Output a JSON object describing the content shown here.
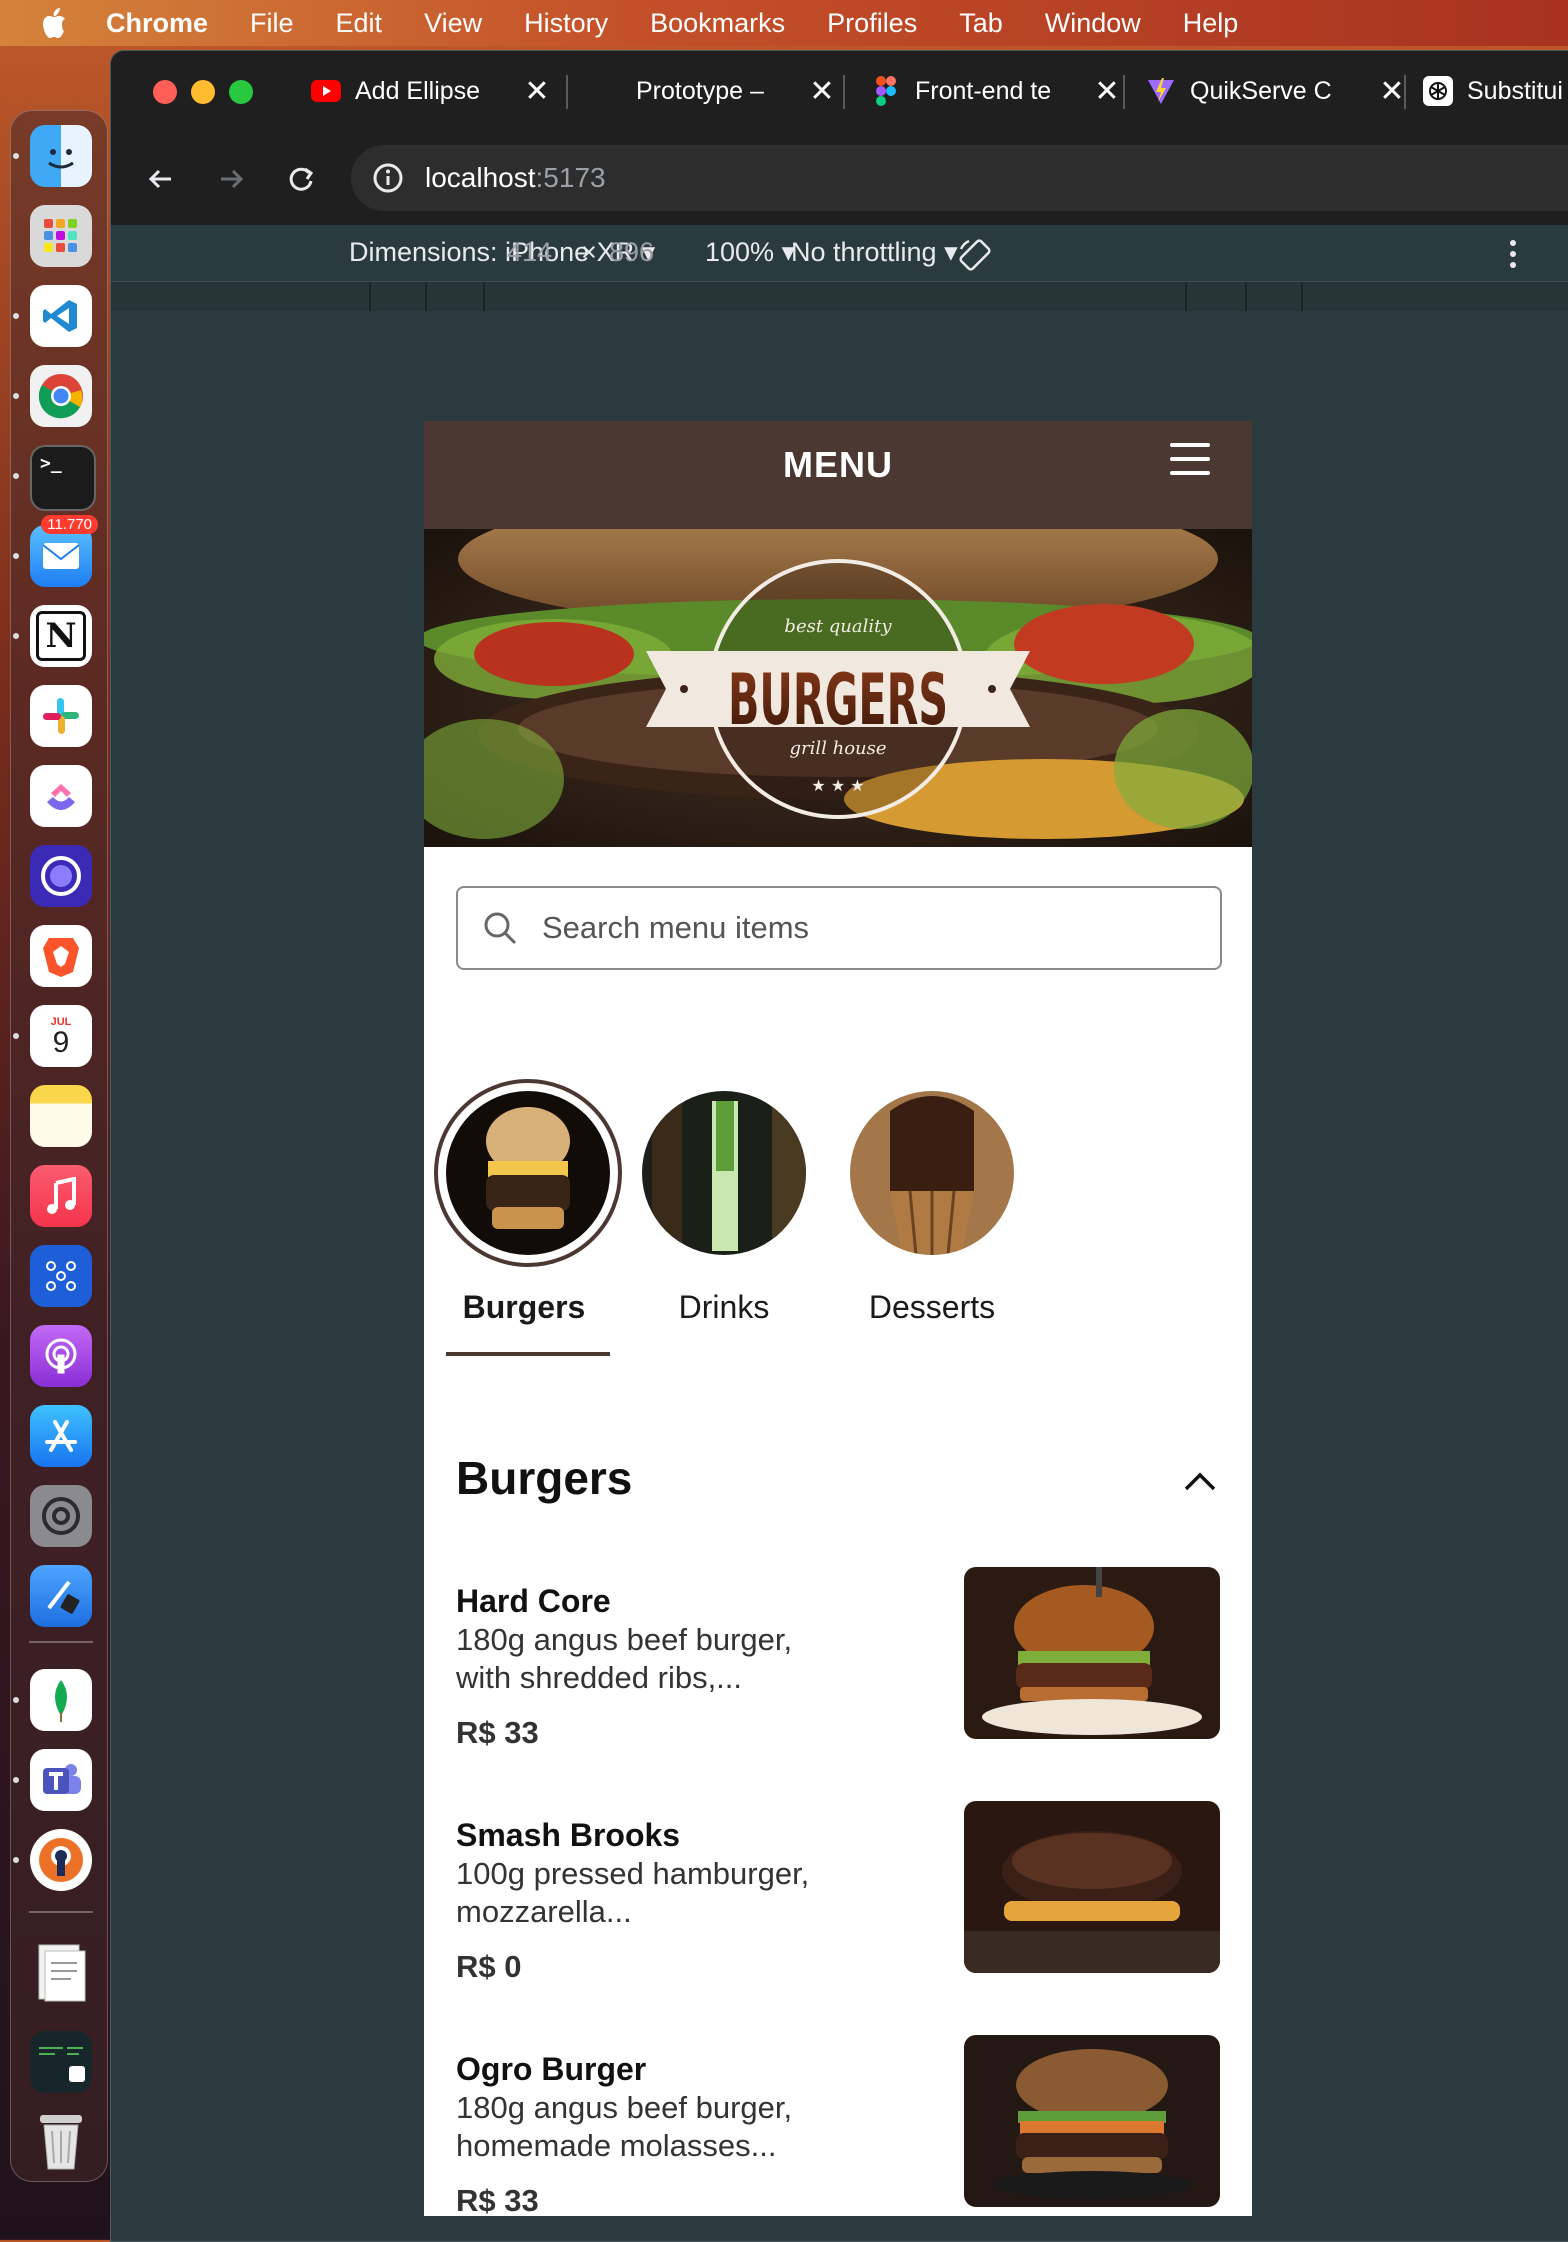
{
  "menubar": {
    "items": [
      "Chrome",
      "File",
      "Edit",
      "View",
      "History",
      "Bookmarks",
      "Profiles",
      "Tab",
      "Window",
      "Help"
    ]
  },
  "dock": {
    "mail_badge": "11.770",
    "calendar_month": "JUL",
    "calendar_day": "9",
    "icons": [
      "finder-icon",
      "launchpad-icon",
      "vscode-icon",
      "chrome-icon",
      "terminal-icon",
      "mail-icon",
      "notion-icon",
      "slack-icon",
      "clickup-icon",
      "linear-icon",
      "brave-icon",
      "calendar-icon",
      "notes-icon",
      "music-icon",
      "graph-icon",
      "podcasts-icon",
      "app-store-icon",
      "system-settings-icon",
      "xcode-icon",
      "mongodb-icon",
      "teams-icon",
      "vpn-icon",
      "documents-icon",
      "screenshot-icon",
      "trash-icon"
    ]
  },
  "browser": {
    "tabs": [
      {
        "title": "Add Ellipse",
        "favicon": "youtube-icon"
      },
      {
        "title": "Prototype –",
        "favicon": "figma-icon"
      },
      {
        "title": "Front-end te",
        "favicon": "figma-icon"
      },
      {
        "title": "QuikServe C",
        "favicon": "vite-icon"
      },
      {
        "title": "Substitui",
        "favicon": "chatgpt-icon"
      }
    ],
    "url_host": "localhost",
    "url_port": ":5173"
  },
  "devtools": {
    "dimensions_label": "Dimensions: iPhone XR",
    "width": "414",
    "times": "×",
    "height": "896",
    "zoom": "100%",
    "throttling": "No throttling"
  },
  "app": {
    "header_title": "MENU",
    "hero_badge_top": "best quality",
    "hero_title": "BURGERS",
    "hero_badge_bottom": "grill house",
    "hero_stars": "★ ★ ★",
    "search_placeholder": "Search menu items",
    "categories": [
      {
        "label": "Burgers",
        "active": true
      },
      {
        "label": "Drinks",
        "active": false
      },
      {
        "label": "Desserts",
        "active": false
      }
    ],
    "section_title": "Burgers",
    "items": [
      {
        "name": "Hard Core",
        "desc": "180g angus beef burger, with shredded ribs,...",
        "price": "R$ 33"
      },
      {
        "name": "Smash Brooks",
        "desc": "100g pressed hamburger, mozzarella...",
        "price": "R$ 0"
      },
      {
        "name": "Ogro Burger",
        "desc": "180g angus beef burger, homemade molasses...",
        "price": "R$ 33"
      }
    ]
  },
  "colors": {
    "brand": "#4b3832",
    "devtools_bg": "#2b3a3e",
    "browser_dark": "#1f1f1f"
  }
}
